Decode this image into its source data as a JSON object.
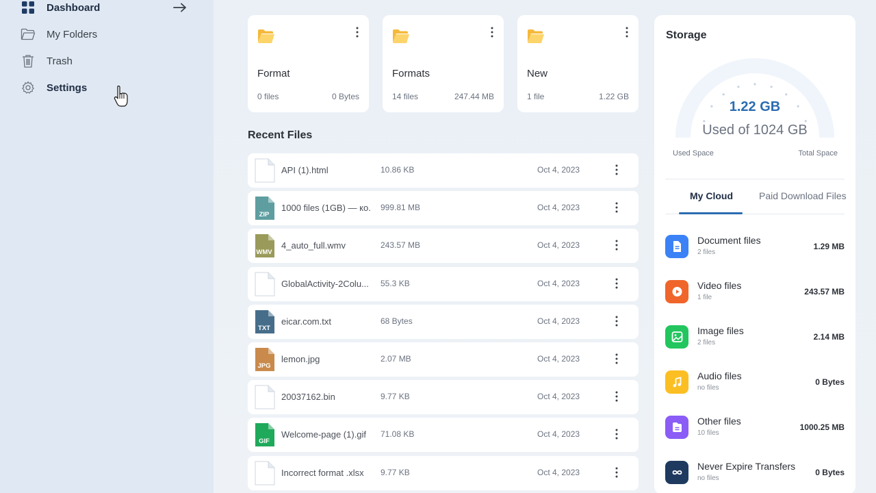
{
  "sidebar": {
    "items": [
      {
        "label": "Dashboard",
        "icon": "dashboard-icon"
      },
      {
        "label": "My Folders",
        "icon": "folder-outline-icon"
      },
      {
        "label": "Trash",
        "icon": "trash-icon"
      },
      {
        "label": "Settings",
        "icon": "gear-icon"
      }
    ]
  },
  "folders": [
    {
      "name": "Format",
      "count": "0 files",
      "size": "0 Bytes"
    },
    {
      "name": "Formats",
      "count": "14 files",
      "size": "247.44 MB"
    },
    {
      "name": "New",
      "count": "1 file",
      "size": "1.22 GB"
    }
  ],
  "recent": {
    "title": "Recent Files",
    "files": [
      {
        "name": "API (1).html",
        "size": "10.86 KB",
        "date": "Oct 4, 2023",
        "type": "blank"
      },
      {
        "name": "1000 files (1GB) — ко...",
        "size": "999.81 MB",
        "date": "Oct 4, 2023",
        "type": "ZIP"
      },
      {
        "name": "4_auto_full.wmv",
        "size": "243.57 MB",
        "date": "Oct 4, 2023",
        "type": "WMV"
      },
      {
        "name": "GlobalActivity-2Colu...",
        "size": "55.3 KB",
        "date": "Oct 4, 2023",
        "type": "blank"
      },
      {
        "name": "eicar.com.txt",
        "size": "68 Bytes",
        "date": "Oct 4, 2023",
        "type": "TXT"
      },
      {
        "name": "lemon.jpg",
        "size": "2.07 MB",
        "date": "Oct 4, 2023",
        "type": "JPG"
      },
      {
        "name": "20037162.bin",
        "size": "9.77 KB",
        "date": "Oct 4, 2023",
        "type": "blank"
      },
      {
        "name": "Welcome-page (1).gif",
        "size": "71.08 KB",
        "date": "Oct 4, 2023",
        "type": "GIF"
      },
      {
        "name": "Incorrect format .xlsx",
        "size": "9.77 KB",
        "date": "Oct 4, 2023",
        "type": "blank"
      }
    ]
  },
  "storage": {
    "title": "Storage",
    "used": "1.22 GB",
    "of": "Used of 1024 GB",
    "used_fraction": 0.0012,
    "label_left": "Used Space",
    "label_right": "Total Space",
    "tabs": [
      "My Cloud",
      "Paid Download Files"
    ],
    "categories": [
      {
        "name": "Document files",
        "sub": "2 files",
        "size": "1.29 MB",
        "color": "#3b82f6",
        "icon": "document-icon"
      },
      {
        "name": "Video files",
        "sub": "1 file",
        "size": "243.57 MB",
        "color": "#f0652a",
        "icon": "play-icon"
      },
      {
        "name": "Image files",
        "sub": "2 files",
        "size": "2.14 MB",
        "color": "#22c55e",
        "icon": "image-icon"
      },
      {
        "name": "Audio files",
        "sub": "no files",
        "size": "0 Bytes",
        "color": "#fbbf24",
        "icon": "music-icon"
      },
      {
        "name": "Other files",
        "sub": "10 files",
        "size": "1000.25 MB",
        "color": "#8b5cf6",
        "icon": "file-icon"
      },
      {
        "name": "Never Expire Transfers",
        "sub": "no files",
        "size": "0 Bytes",
        "color": "#1e3a5f",
        "icon": "infinity-icon"
      }
    ]
  },
  "colors": {
    "accent": "#2b6cb0",
    "folder": "#f6b93b",
    "sidebar_bg": "#e0e9f3"
  }
}
